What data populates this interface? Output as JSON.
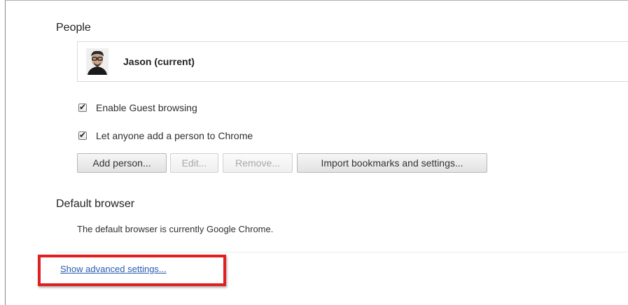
{
  "people": {
    "title": "People",
    "profile": {
      "name": "Jason (current)",
      "avatar_icon": "user-avatar-photo"
    },
    "options": [
      {
        "label": "Enable Guest browsing",
        "checked": true
      },
      {
        "label": "Let anyone add a person to Chrome",
        "checked": true
      }
    ],
    "buttons": {
      "add": "Add person...",
      "edit": "Edit...",
      "remove": "Remove...",
      "import": "Import bookmarks and settings..."
    }
  },
  "default_browser": {
    "title": "Default browser",
    "status": "The default browser is currently Google Chrome."
  },
  "advanced_link": "Show advanced settings...",
  "colors": {
    "link": "#2a5db0",
    "highlight": "#e02020"
  }
}
